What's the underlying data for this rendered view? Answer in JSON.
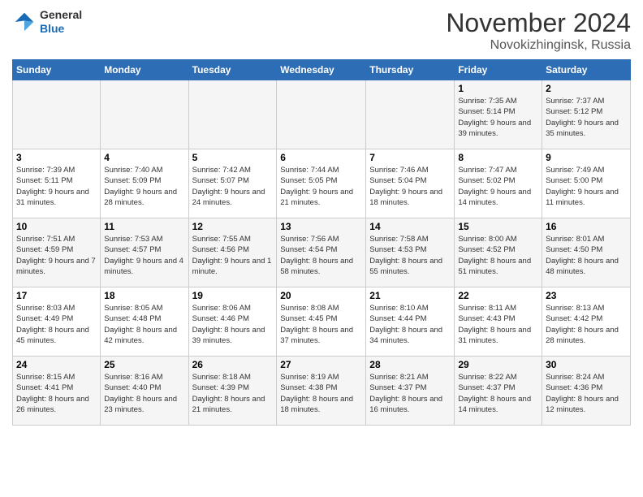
{
  "logo": {
    "general": "General",
    "blue": "Blue"
  },
  "header": {
    "month": "November 2024",
    "location": "Novokizhinginsk, Russia"
  },
  "weekdays": [
    "Sunday",
    "Monday",
    "Tuesday",
    "Wednesday",
    "Thursday",
    "Friday",
    "Saturday"
  ],
  "weeks": [
    [
      {
        "day": "",
        "info": ""
      },
      {
        "day": "",
        "info": ""
      },
      {
        "day": "",
        "info": ""
      },
      {
        "day": "",
        "info": ""
      },
      {
        "day": "",
        "info": ""
      },
      {
        "day": "1",
        "info": "Sunrise: 7:35 AM\nSunset: 5:14 PM\nDaylight: 9 hours and 39 minutes."
      },
      {
        "day": "2",
        "info": "Sunrise: 7:37 AM\nSunset: 5:12 PM\nDaylight: 9 hours and 35 minutes."
      }
    ],
    [
      {
        "day": "3",
        "info": "Sunrise: 7:39 AM\nSunset: 5:11 PM\nDaylight: 9 hours and 31 minutes."
      },
      {
        "day": "4",
        "info": "Sunrise: 7:40 AM\nSunset: 5:09 PM\nDaylight: 9 hours and 28 minutes."
      },
      {
        "day": "5",
        "info": "Sunrise: 7:42 AM\nSunset: 5:07 PM\nDaylight: 9 hours and 24 minutes."
      },
      {
        "day": "6",
        "info": "Sunrise: 7:44 AM\nSunset: 5:05 PM\nDaylight: 9 hours and 21 minutes."
      },
      {
        "day": "7",
        "info": "Sunrise: 7:46 AM\nSunset: 5:04 PM\nDaylight: 9 hours and 18 minutes."
      },
      {
        "day": "8",
        "info": "Sunrise: 7:47 AM\nSunset: 5:02 PM\nDaylight: 9 hours and 14 minutes."
      },
      {
        "day": "9",
        "info": "Sunrise: 7:49 AM\nSunset: 5:00 PM\nDaylight: 9 hours and 11 minutes."
      }
    ],
    [
      {
        "day": "10",
        "info": "Sunrise: 7:51 AM\nSunset: 4:59 PM\nDaylight: 9 hours and 7 minutes."
      },
      {
        "day": "11",
        "info": "Sunrise: 7:53 AM\nSunset: 4:57 PM\nDaylight: 9 hours and 4 minutes."
      },
      {
        "day": "12",
        "info": "Sunrise: 7:55 AM\nSunset: 4:56 PM\nDaylight: 9 hours and 1 minute."
      },
      {
        "day": "13",
        "info": "Sunrise: 7:56 AM\nSunset: 4:54 PM\nDaylight: 8 hours and 58 minutes."
      },
      {
        "day": "14",
        "info": "Sunrise: 7:58 AM\nSunset: 4:53 PM\nDaylight: 8 hours and 55 minutes."
      },
      {
        "day": "15",
        "info": "Sunrise: 8:00 AM\nSunset: 4:52 PM\nDaylight: 8 hours and 51 minutes."
      },
      {
        "day": "16",
        "info": "Sunrise: 8:01 AM\nSunset: 4:50 PM\nDaylight: 8 hours and 48 minutes."
      }
    ],
    [
      {
        "day": "17",
        "info": "Sunrise: 8:03 AM\nSunset: 4:49 PM\nDaylight: 8 hours and 45 minutes."
      },
      {
        "day": "18",
        "info": "Sunrise: 8:05 AM\nSunset: 4:48 PM\nDaylight: 8 hours and 42 minutes."
      },
      {
        "day": "19",
        "info": "Sunrise: 8:06 AM\nSunset: 4:46 PM\nDaylight: 8 hours and 39 minutes."
      },
      {
        "day": "20",
        "info": "Sunrise: 8:08 AM\nSunset: 4:45 PM\nDaylight: 8 hours and 37 minutes."
      },
      {
        "day": "21",
        "info": "Sunrise: 8:10 AM\nSunset: 4:44 PM\nDaylight: 8 hours and 34 minutes."
      },
      {
        "day": "22",
        "info": "Sunrise: 8:11 AM\nSunset: 4:43 PM\nDaylight: 8 hours and 31 minutes."
      },
      {
        "day": "23",
        "info": "Sunrise: 8:13 AM\nSunset: 4:42 PM\nDaylight: 8 hours and 28 minutes."
      }
    ],
    [
      {
        "day": "24",
        "info": "Sunrise: 8:15 AM\nSunset: 4:41 PM\nDaylight: 8 hours and 26 minutes."
      },
      {
        "day": "25",
        "info": "Sunrise: 8:16 AM\nSunset: 4:40 PM\nDaylight: 8 hours and 23 minutes."
      },
      {
        "day": "26",
        "info": "Sunrise: 8:18 AM\nSunset: 4:39 PM\nDaylight: 8 hours and 21 minutes."
      },
      {
        "day": "27",
        "info": "Sunrise: 8:19 AM\nSunset: 4:38 PM\nDaylight: 8 hours and 18 minutes."
      },
      {
        "day": "28",
        "info": "Sunrise: 8:21 AM\nSunset: 4:37 PM\nDaylight: 8 hours and 16 minutes."
      },
      {
        "day": "29",
        "info": "Sunrise: 8:22 AM\nSunset: 4:37 PM\nDaylight: 8 hours and 14 minutes."
      },
      {
        "day": "30",
        "info": "Sunrise: 8:24 AM\nSunset: 4:36 PM\nDaylight: 8 hours and 12 minutes."
      }
    ]
  ]
}
